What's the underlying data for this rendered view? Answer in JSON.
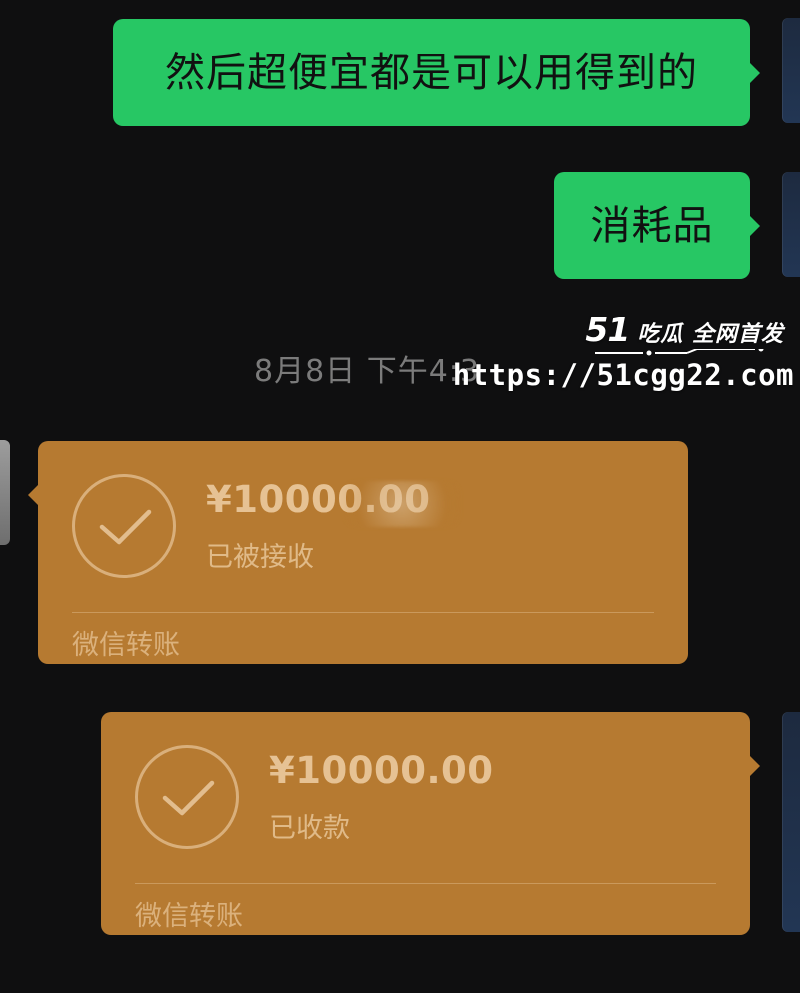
{
  "chat": {
    "messages": [
      {
        "text": "然后超便宜都是可以用得到的"
      },
      {
        "text": "消耗品"
      }
    ],
    "timestamp": "8月8日 下午4:3",
    "transfers": [
      {
        "amount": "¥10000.00",
        "status": "已被接收",
        "footer": "微信转账",
        "check_icon": "check-icon"
      },
      {
        "amount": "¥10000.00",
        "status": "已收款",
        "footer": "微信转账",
        "check_icon": "check-icon"
      }
    ]
  },
  "watermark": {
    "brand_number": "51",
    "brand_text": "吃瓜 全网首发",
    "url": "https://51cgg22.com"
  },
  "colors": {
    "background": "#0f0f10",
    "green_bubble": "#27c764",
    "transfer_card": "#b67a31"
  }
}
